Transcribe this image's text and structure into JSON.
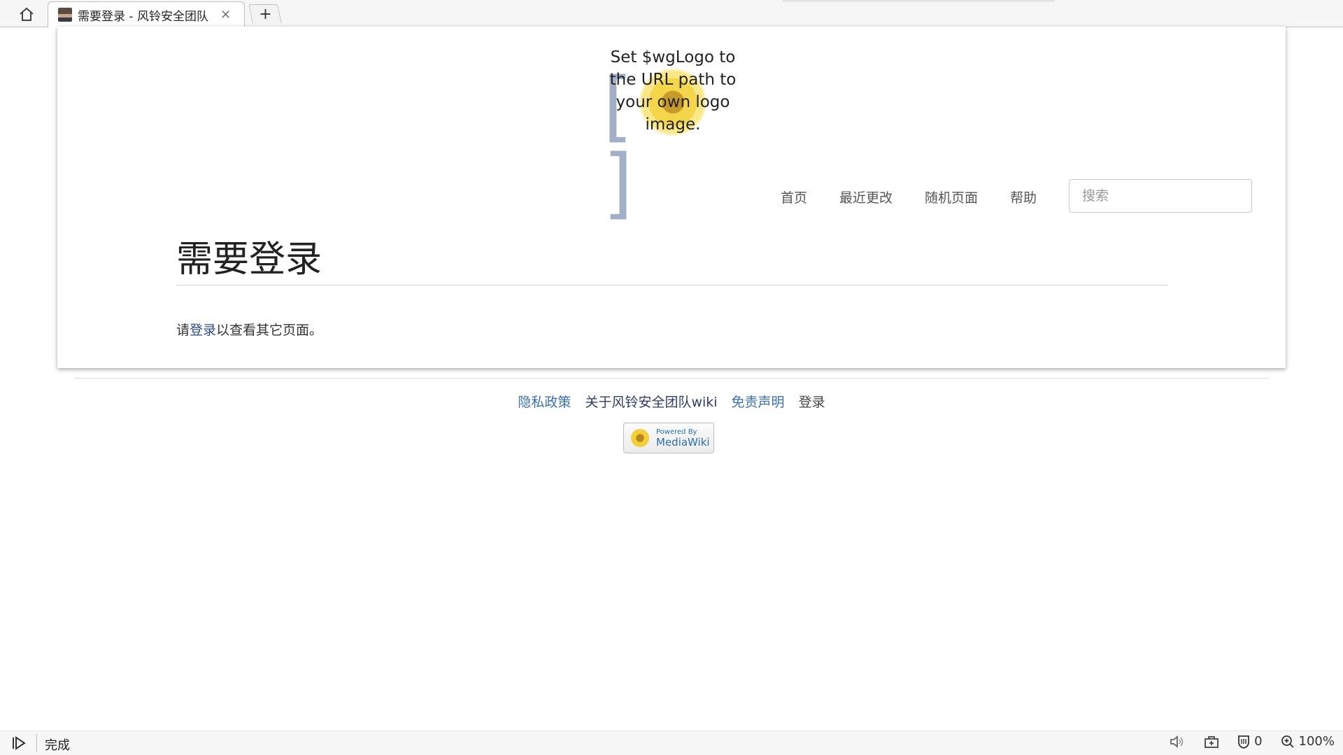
{
  "browser": {
    "tab_title": "需要登录 - 风铃安全团队",
    "tab_close": "✕",
    "newtab_label": "+",
    "icons": {
      "home": "home-icon",
      "favicon": "avatar-favicon",
      "close": "close-icon",
      "newtab": "plus-icon"
    }
  },
  "site": {
    "logo_text": "Set $wgLogo to the URL path to your own logo image.",
    "nav": [
      "首页",
      "最近更改",
      "随机页面",
      "帮助"
    ],
    "search_placeholder": "搜索"
  },
  "page": {
    "title": "需要登录",
    "notice_before": "请",
    "notice_link": "登录",
    "notice_after": "以查看其它页面。"
  },
  "footer": {
    "links": [
      "隐私政策",
      "关于风铃安全团队wiki",
      "免责声明",
      "登录"
    ],
    "powered_small": "Powered By",
    "powered_big": "MediaWiki"
  },
  "statusbar": {
    "status": "完成",
    "blocked_count": "0",
    "zoom": "100%"
  },
  "colors": {
    "link": "#3a6fb0",
    "link_dark": "#2c3e66",
    "title": "#222222"
  }
}
